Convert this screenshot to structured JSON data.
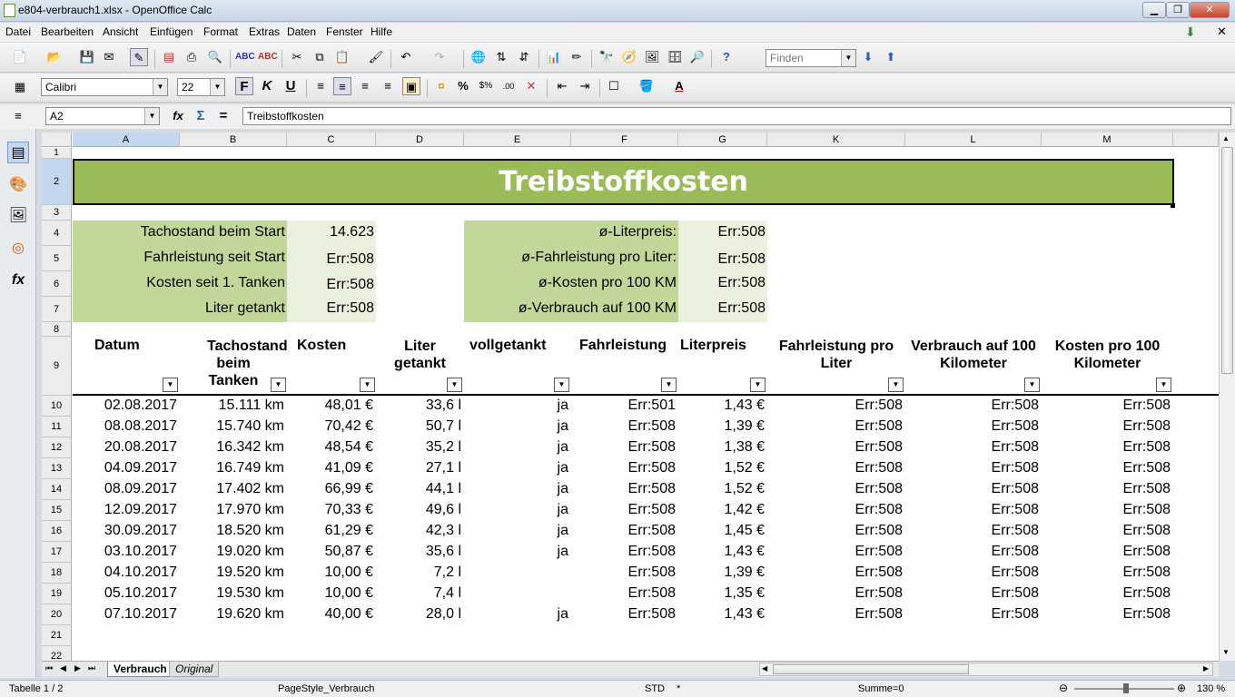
{
  "window": {
    "title": "e804-verbrauch1.xlsx - OpenOffice Calc"
  },
  "menu": [
    "Datei",
    "Bearbeiten",
    "Ansicht",
    "Einfügen",
    "Format",
    "Extras",
    "Daten",
    "Fenster",
    "Hilfe"
  ],
  "toolbar": {
    "find_placeholder": "Finden"
  },
  "format": {
    "font_name": "Calibri",
    "font_size": "22"
  },
  "formula": {
    "cell_ref": "A2",
    "content": "Treibstoffkosten"
  },
  "columns": [
    "A",
    "B",
    "C",
    "D",
    "E",
    "F",
    "G",
    "K",
    "L",
    "M"
  ],
  "rows": [
    "1",
    "2",
    "3",
    "4",
    "5",
    "6",
    "7",
    "8",
    "9",
    "10",
    "11",
    "12",
    "13",
    "14",
    "15",
    "16",
    "17",
    "18",
    "19",
    "20",
    "21",
    "22"
  ],
  "sheet": {
    "title": "Treibstoffkosten",
    "summary_left": [
      {
        "label": "Tachostand beim Start",
        "value": "14.623"
      },
      {
        "label": "Fahrleistung seit Start",
        "value": "Err:508"
      },
      {
        "label": "Kosten seit 1. Tanken",
        "value": "Err:508"
      },
      {
        "label": "Liter getankt",
        "value": "Err:508"
      }
    ],
    "summary_right": [
      {
        "label": "ø-Literpreis:",
        "value": "Err:508"
      },
      {
        "label": "ø-Fahrleistung pro Liter:",
        "value": "Err:508"
      },
      {
        "label": "ø-Kosten pro 100 KM",
        "value": "Err:508"
      },
      {
        "label": "ø-Verbrauch auf 100 KM",
        "value": "Err:508"
      }
    ],
    "headers": [
      "Datum",
      "Tachostand beim Tanken",
      "Kosten",
      "Liter getankt",
      "vollgetankt",
      "Fahrleistung",
      "Literpreis",
      "Fahrleistung pro Liter",
      "Verbrauch auf 100 Kilometer",
      "Kosten pro 100 Kilometer"
    ],
    "data": [
      [
        "02.08.2017",
        "15.111 km",
        "48,01 €",
        "33,6 l",
        "ja",
        "Err:501",
        "1,43 €",
        "Err:508",
        "Err:508",
        "Err:508"
      ],
      [
        "08.08.2017",
        "15.740 km",
        "70,42 €",
        "50,7 l",
        "ja",
        "Err:508",
        "1,39 €",
        "Err:508",
        "Err:508",
        "Err:508"
      ],
      [
        "20.08.2017",
        "16.342 km",
        "48,54 €",
        "35,2 l",
        "ja",
        "Err:508",
        "1,38 €",
        "Err:508",
        "Err:508",
        "Err:508"
      ],
      [
        "04.09.2017",
        "16.749 km",
        "41,09 €",
        "27,1 l",
        "ja",
        "Err:508",
        "1,52 €",
        "Err:508",
        "Err:508",
        "Err:508"
      ],
      [
        "08.09.2017",
        "17.402 km",
        "66,99 €",
        "44,1 l",
        "ja",
        "Err:508",
        "1,52 €",
        "Err:508",
        "Err:508",
        "Err:508"
      ],
      [
        "12.09.2017",
        "17.970 km",
        "70,33 €",
        "49,6 l",
        "ja",
        "Err:508",
        "1,42 €",
        "Err:508",
        "Err:508",
        "Err:508"
      ],
      [
        "30.09.2017",
        "18.520 km",
        "61,29 €",
        "42,3 l",
        "ja",
        "Err:508",
        "1,45 €",
        "Err:508",
        "Err:508",
        "Err:508"
      ],
      [
        "03.10.2017",
        "19.020 km",
        "50,87 €",
        "35,6 l",
        "ja",
        "Err:508",
        "1,43 €",
        "Err:508",
        "Err:508",
        "Err:508"
      ],
      [
        "04.10.2017",
        "19.520 km",
        "10,00 €",
        "7,2 l",
        "",
        "Err:508",
        "1,39 €",
        "Err:508",
        "Err:508",
        "Err:508"
      ],
      [
        "05.10.2017",
        "19.530 km",
        "10,00 €",
        "7,4 l",
        "",
        "Err:508",
        "1,35 €",
        "Err:508",
        "Err:508",
        "Err:508"
      ],
      [
        "07.10.2017",
        "19.620 km",
        "40,00 €",
        "28,0 l",
        "ja",
        "Err:508",
        "1,43 €",
        "Err:508",
        "Err:508",
        "Err:508"
      ]
    ]
  },
  "tabs": [
    "Verbrauch",
    "Original"
  ],
  "status": {
    "sheet": "Tabelle 1 / 2",
    "page_style": "PageStyle_Verbrauch",
    "mode": "STD",
    "modified": "*",
    "sum": "Summe=0",
    "zoom": "130 %"
  }
}
